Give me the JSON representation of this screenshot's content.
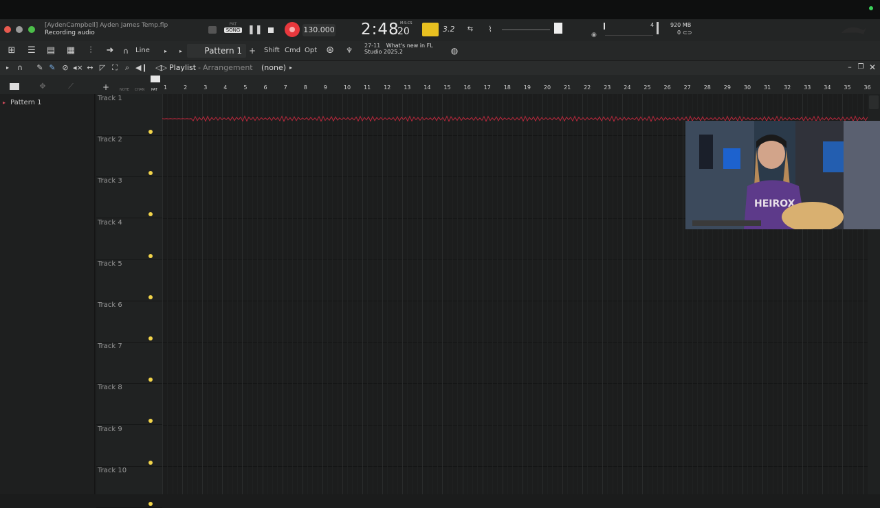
{
  "window": {
    "user_project": "[AydenCampbell] Ayden James Temp.flp",
    "status": "Recording audio"
  },
  "transport": {
    "mode_pat": "PAT",
    "mode_song": "SONG",
    "tempo": "130.000",
    "time_main": "2:48",
    "time_sub": "20",
    "time_unit": "M:S:CS",
    "pattern_step": "3.2",
    "memory": "920 MB",
    "cpu_count": "0",
    "mixer_num": "4"
  },
  "toolbar": {
    "snap_label": "Line",
    "pattern_name": "Pattern 1",
    "shift_label": "Shift",
    "cmd_label": "Cmd",
    "opt_label": "Opt",
    "news_date": "27-11",
    "news_title": "What's new in FL",
    "news_sub": "Studio 2025.2"
  },
  "playlist": {
    "title": "Playlist",
    "sep": "-",
    "subtitle": "Arrangement",
    "selection": "(none)",
    "header_labels": [
      "NOTE",
      "CHAN",
      "PAT"
    ]
  },
  "browser": {
    "items": [
      {
        "label": "Pattern 1"
      }
    ]
  },
  "ruler": {
    "bars": [
      "1",
      "2",
      "3",
      "4",
      "5",
      "6",
      "7",
      "8",
      "9",
      "10",
      "11",
      "12",
      "13",
      "14",
      "15",
      "16",
      "17",
      "18",
      "19",
      "20",
      "21",
      "22",
      "23",
      "24",
      "25",
      "26",
      "27",
      "28",
      "29",
      "30",
      "31",
      "32",
      "33",
      "34",
      "35",
      "36"
    ]
  },
  "tracks": [
    {
      "label": "Track 1"
    },
    {
      "label": "Track 2"
    },
    {
      "label": "Track 3"
    },
    {
      "label": "Track 4"
    },
    {
      "label": "Track 5"
    },
    {
      "label": "Track 6"
    },
    {
      "label": "Track 7"
    },
    {
      "label": "Track 8"
    },
    {
      "label": "Track 9"
    },
    {
      "label": "Track 10"
    }
  ],
  "colors": {
    "record": "#e8383d",
    "audio_clip": "#b8283c",
    "track_led": "#f2d44a",
    "accent_yellow": "#e8c020"
  }
}
